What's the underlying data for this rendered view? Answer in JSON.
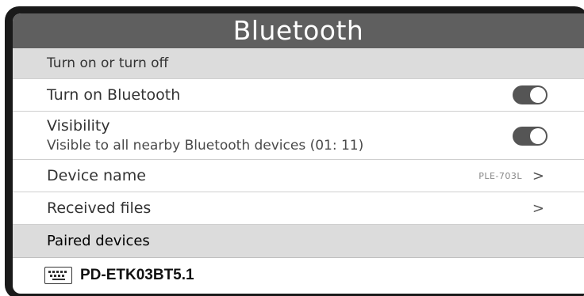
{
  "header": {
    "title": "Bluetooth"
  },
  "sections": {
    "power_header": "Turn on or turn off",
    "paired_header": "Paired devices"
  },
  "items": {
    "turn_on": {
      "label": "Turn on Bluetooth",
      "enabled": true
    },
    "visibility": {
      "label": "Visibility",
      "sublabel": "Visible to all nearby Bluetooth devices  (01:  11)",
      "enabled": true
    },
    "device_name": {
      "label": "Device  name",
      "value": "PLE-703L",
      "chevron": ">"
    },
    "received_files": {
      "label": "Received files",
      "chevron": ">"
    }
  },
  "paired_devices": [
    {
      "name": "PD-ETK03BT5.1",
      "icon": "keyboard-icon"
    }
  ],
  "colors": {
    "title_bg": "#5f5f5f",
    "section_bg": "#dcdcdc",
    "toggle_on": "#555555",
    "bezel": "#1a1a1a"
  }
}
